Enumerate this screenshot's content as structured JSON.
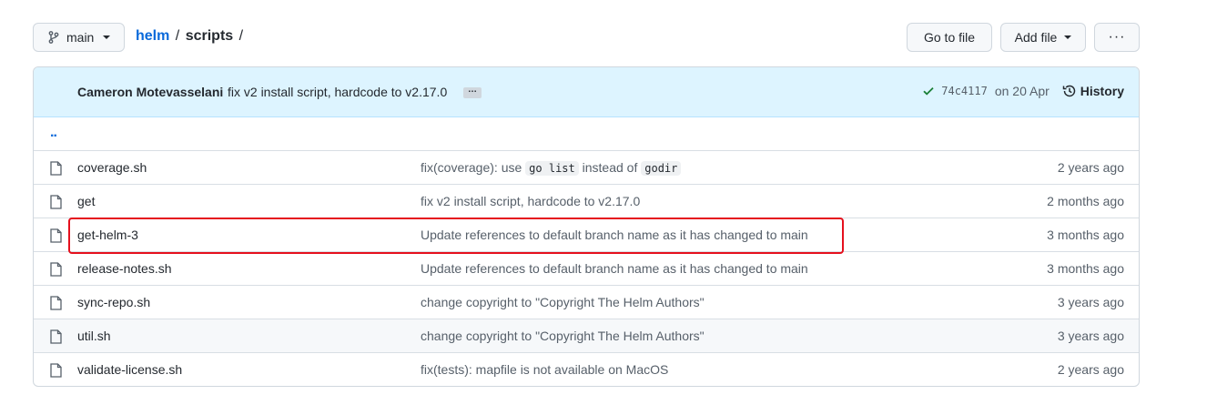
{
  "toolbar": {
    "branch": "main",
    "breadcrumb": {
      "repo": "helm",
      "sep1": "/",
      "dir": "scripts",
      "sep2": "/"
    },
    "goto_file": "Go to file",
    "add_file": "Add file",
    "more": "···"
  },
  "latest_commit": {
    "author": "Cameron Motevasselani",
    "message": "fix v2 install script, hardcode to v2.17.0",
    "ellipsis": "…",
    "status_icon": "check-icon",
    "sha": "74c4117",
    "date": "on 20 Apr",
    "history_label": "History"
  },
  "parent_link": "..",
  "files": [
    {
      "name": "coverage.sh",
      "msg_parts": [
        "fix(coverage): use ",
        "go list",
        " instead of ",
        "godir"
      ],
      "age": "2 years ago"
    },
    {
      "name": "get",
      "message": "fix v2 install script, hardcode to v2.17.0",
      "age": "2 months ago"
    },
    {
      "name": "get-helm-3",
      "message": "Update references to default branch name as it has changed to main",
      "age": "3 months ago"
    },
    {
      "name": "release-notes.sh",
      "message": "Update references to default branch name as it has changed to main",
      "age": "3 months ago"
    },
    {
      "name": "sync-repo.sh",
      "message": "change copyright to \"Copyright The Helm Authors\"",
      "age": "3 years ago"
    },
    {
      "name": "util.sh",
      "message": "change copyright to \"Copyright The Helm Authors\"",
      "age": "3 years ago"
    },
    {
      "name": "validate-license.sh",
      "message": "fix(tests): mapfile is not available on MacOS",
      "age": "2 years ago"
    }
  ],
  "colors": {
    "link": "#0969da",
    "highlight": "#e5101d",
    "commit_bg": "#ddf4ff",
    "success": "#1a7f37"
  }
}
